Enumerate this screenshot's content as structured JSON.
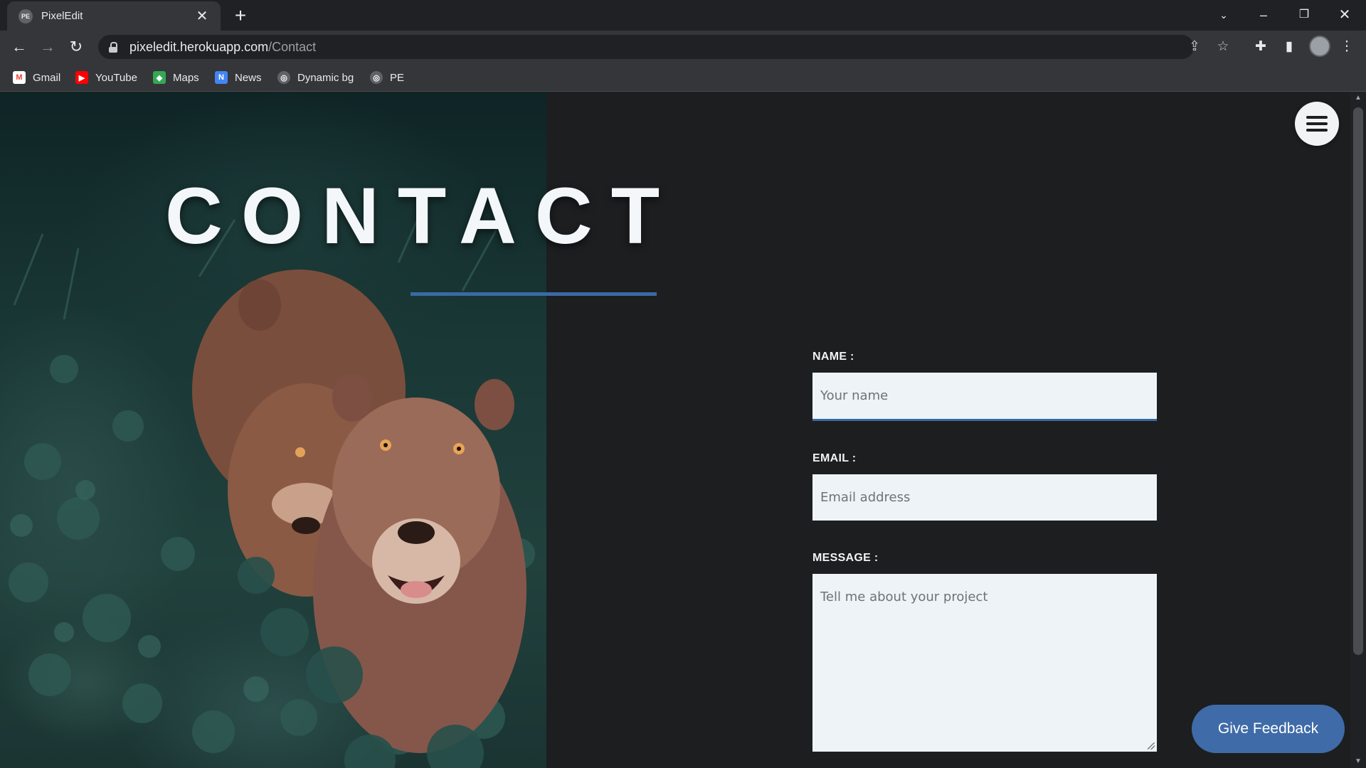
{
  "browser": {
    "tab": {
      "title": "PixelEdit",
      "favicon": "PE"
    },
    "address": {
      "host": "pixeledit.herokuapp.com",
      "path": "/Contact"
    },
    "bookmarks": [
      {
        "label": "Gmail",
        "icon": "gmail-icon",
        "color": "#ea4335",
        "glyph": "M"
      },
      {
        "label": "YouTube",
        "icon": "youtube-icon",
        "color": "#ff0000",
        "glyph": "▶"
      },
      {
        "label": "Maps",
        "icon": "maps-icon",
        "color": "#34a853",
        "glyph": "◆"
      },
      {
        "label": "News",
        "icon": "news-icon",
        "color": "#4285f4",
        "glyph": "N"
      },
      {
        "label": "Dynamic bg",
        "icon": "globe-icon",
        "color": "#5f6368",
        "glyph": "◎"
      },
      {
        "label": "PE",
        "icon": "globe-icon",
        "color": "#5f6368",
        "glyph": "◎"
      }
    ]
  },
  "page": {
    "title": "CONTACT",
    "accent_color": "#3a6aa6",
    "form": {
      "name_label": "NAME :",
      "name_placeholder": "Your name",
      "email_label": "EMAIL :",
      "email_placeholder": "Email address",
      "message_label": "MESSAGE :",
      "message_placeholder": "Tell me about your project"
    },
    "feedback_button": "Give Feedback"
  }
}
